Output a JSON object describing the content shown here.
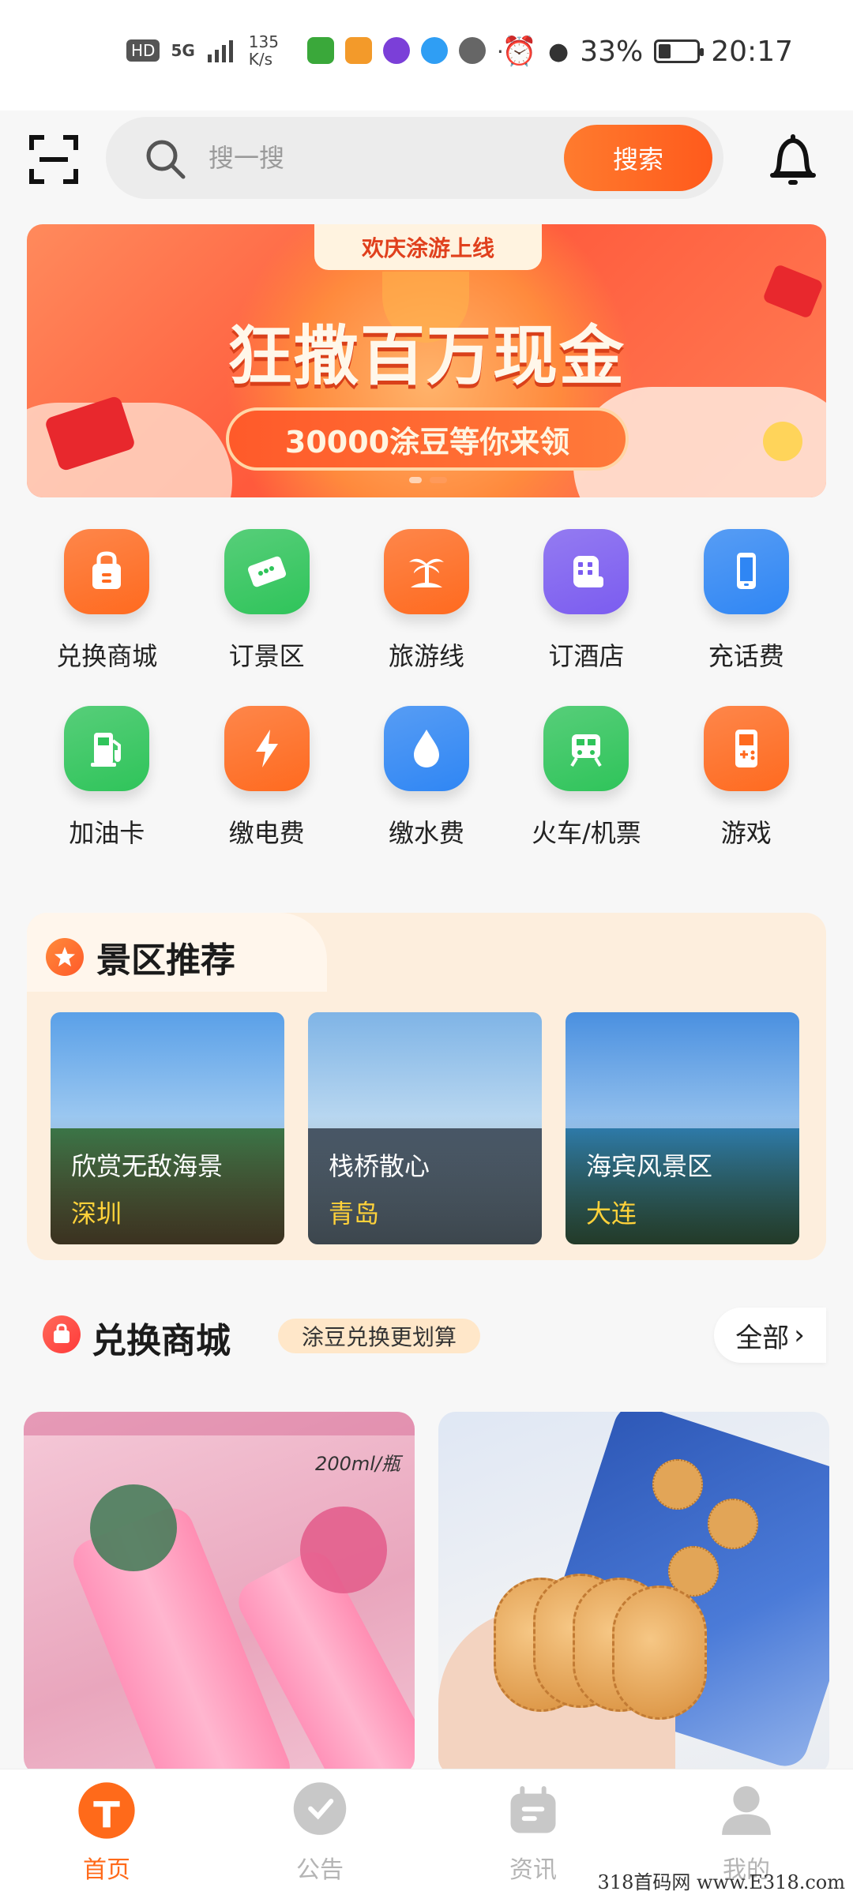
{
  "status_bar": {
    "left": [
      "HD",
      "5G",
      "135 K/s"
    ],
    "battery": "33%",
    "battery_level": 0.33,
    "time": "20:17"
  },
  "search": {
    "placeholder": "搜一搜",
    "button_label": "搜索"
  },
  "banner": {
    "tag": "欢庆涂游上线",
    "title": "狂撒百万现金",
    "subtitle": "30000涂豆等你来领",
    "slide_count": 2,
    "active_slide": 2
  },
  "quick_grid": [
    {
      "label": "兑换商城",
      "icon": "shopping-bag-icon",
      "color": "#ff6a1f"
    },
    {
      "label": "订景区",
      "icon": "ticket-icon",
      "color": "#2fc45a"
    },
    {
      "label": "旅游线",
      "icon": "palm-tree-icon",
      "color": "#ff6a1f"
    },
    {
      "label": "订酒店",
      "icon": "hotel-icon",
      "color": "#7b5cf0"
    },
    {
      "label": "充话费",
      "icon": "phone-icon",
      "color": "#2f86f4"
    },
    {
      "label": "加油卡",
      "icon": "fuel-pump-icon",
      "color": "#2fc45a"
    },
    {
      "label": "缴电费",
      "icon": "lightning-icon",
      "color": "#ff6a1f"
    },
    {
      "label": "缴水费",
      "icon": "water-drop-icon",
      "color": "#2f86f4"
    },
    {
      "label": "火车/机票",
      "icon": "train-icon",
      "color": "#2fc45a"
    },
    {
      "label": "游戏",
      "icon": "gamepad-icon",
      "color": "#ff6a1f"
    }
  ],
  "scenic": {
    "title": "景区推荐",
    "cards": [
      {
        "name": "欣赏无敌海景",
        "city": "深圳"
      },
      {
        "name": "栈桥散心",
        "city": "青岛"
      },
      {
        "name": "海宾风景区",
        "city": "大连"
      }
    ]
  },
  "mall": {
    "title": "兑换商城",
    "tag": "涂豆兑换更划算",
    "all_label": "全部",
    "products": [
      {
        "caption": "200ml/瓶"
      },
      {
        "caption": ""
      }
    ]
  },
  "bottom_nav": [
    {
      "label": "首页",
      "icon": "home-icon",
      "active": true
    },
    {
      "label": "公告",
      "icon": "announcement-icon",
      "active": false
    },
    {
      "label": "资讯",
      "icon": "news-icon",
      "active": false
    },
    {
      "label": "我的",
      "icon": "profile-icon",
      "active": false
    }
  ],
  "watermark": "318首码网  www.E318.com",
  "colors": {
    "accent": "#ff6a1a",
    "scenic_bg": "#fdeedd",
    "city_text": "#ffd23a"
  }
}
